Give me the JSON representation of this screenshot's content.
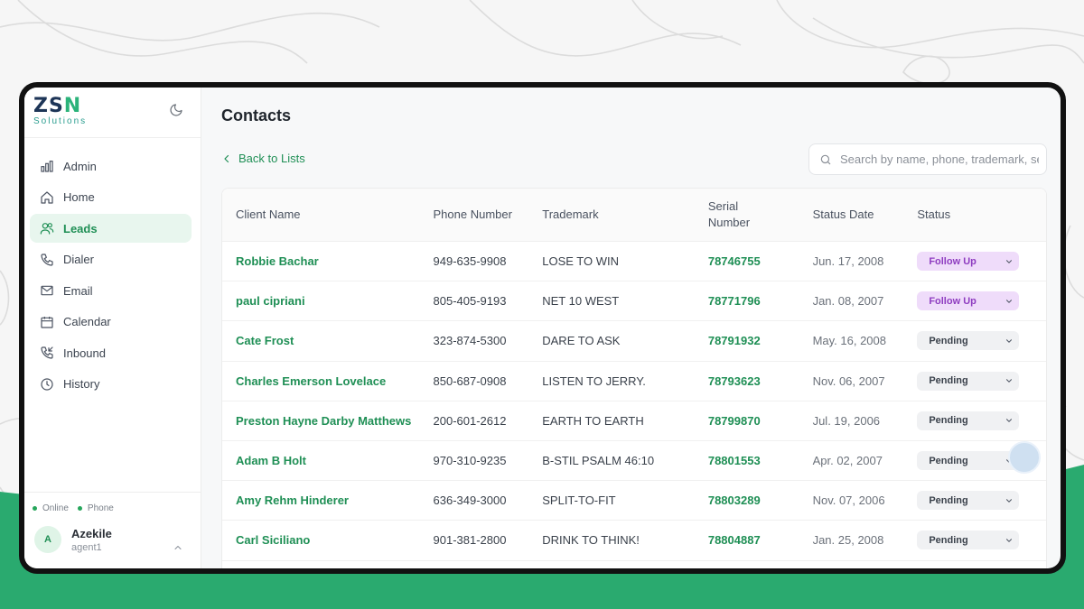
{
  "colors": {
    "accent": "#1f8f55",
    "brand_dark": "#1d3557",
    "brand_green": "#2bb37a",
    "background_green": "#2aaa6f",
    "follow_up_bg": "#efdcfa",
    "follow_up_text": "#8e3cc0",
    "pending_bg": "#f0f1f3",
    "pending_text": "#3a414b"
  },
  "brand": {
    "logo_main_left": "ZS",
    "logo_main_right": "N",
    "logo_sub": "Solutions"
  },
  "sidebar": {
    "items": [
      {
        "label": "Admin",
        "icon": "bar-chart-icon"
      },
      {
        "label": "Home",
        "icon": "home-icon"
      },
      {
        "label": "Leads",
        "icon": "users-icon",
        "active": true
      },
      {
        "label": "Dialer",
        "icon": "phone-icon"
      },
      {
        "label": "Email",
        "icon": "mail-icon"
      },
      {
        "label": "Calendar",
        "icon": "calendar-icon"
      },
      {
        "label": "Inbound",
        "icon": "phone-incoming-icon"
      },
      {
        "label": "History",
        "icon": "clock-icon"
      }
    ],
    "status": {
      "online": "Online",
      "phone": "Phone"
    },
    "user": {
      "initial": "A",
      "name": "Azekile",
      "role": "agent1"
    }
  },
  "main": {
    "title": "Contacts",
    "back_label": "Back to Lists",
    "search_placeholder": "Search by name, phone, trademark, serial...",
    "columns": {
      "client": "Client Name",
      "phone": "Phone Number",
      "trademark": "Trademark",
      "serial_1": "Serial",
      "serial_2": "Number",
      "date": "Status Date",
      "status": "Status"
    },
    "rows": [
      {
        "name": "Robbie Bachar",
        "phone": "949-635-9908",
        "trademark": "LOSE TO WIN",
        "serial": "78746755",
        "date": "Jun. 17, 2008",
        "status": "Follow Up"
      },
      {
        "name": "paul cipriani",
        "phone": "805-405-9193",
        "trademark": "NET 10 WEST",
        "serial": "78771796",
        "date": "Jan. 08, 2007",
        "status": "Follow Up"
      },
      {
        "name": "Cate Frost",
        "phone": "323-874-5300",
        "trademark": "DARE TO ASK",
        "serial": "78791932",
        "date": "May. 16, 2008",
        "status": "Pending"
      },
      {
        "name": "Charles Emerson Lovelace",
        "phone": "850-687-0908",
        "trademark": "LISTEN TO JERRY.",
        "serial": "78793623",
        "date": "Nov. 06, 2007",
        "status": "Pending"
      },
      {
        "name": "Preston Hayne Darby Matthews",
        "phone": "200-601-2612",
        "trademark": "EARTH TO EARTH",
        "serial": "78799870",
        "date": "Jul. 19, 2006",
        "status": "Pending"
      },
      {
        "name": "Adam B Holt",
        "phone": "970-310-9235",
        "trademark": "B-STIL PSALM 46:10",
        "serial": "78801553",
        "date": "Apr. 02, 2007",
        "status": "Pending"
      },
      {
        "name": "Amy Rehm Hinderer",
        "phone": "636-349-3000",
        "trademark": "SPLIT-TO-FIT",
        "serial": "78803289",
        "date": "Nov. 07, 2006",
        "status": "Pending"
      },
      {
        "name": "Carl Siciliano",
        "phone": "901-381-2800",
        "trademark": "DRINK TO THINK!",
        "serial": "78804887",
        "date": "Jan. 25, 2008",
        "status": "Pending"
      }
    ]
  }
}
